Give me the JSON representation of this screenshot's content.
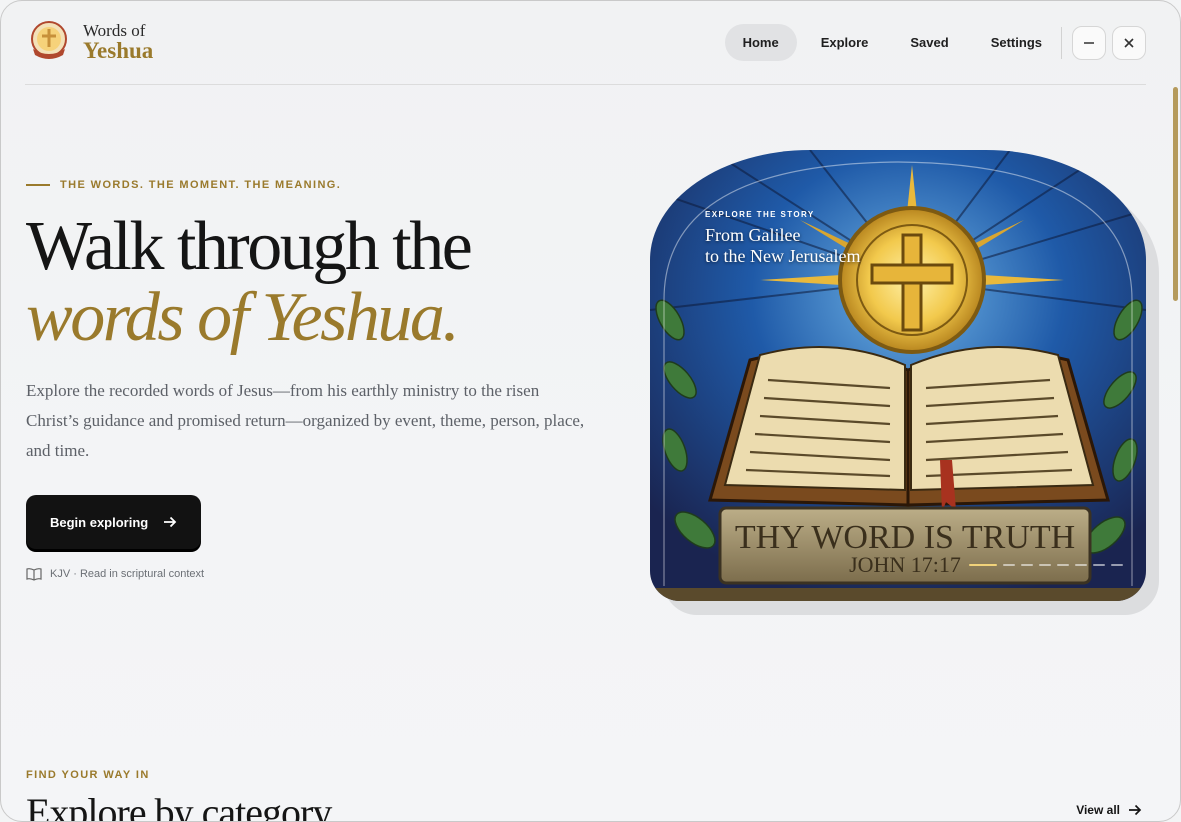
{
  "brand": {
    "top": "Words of",
    "main": "Yeshua"
  },
  "nav": [
    {
      "label": "Home",
      "active": true
    },
    {
      "label": "Explore",
      "active": false
    },
    {
      "label": "Saved",
      "active": false
    },
    {
      "label": "Settings",
      "active": false
    }
  ],
  "window_controls": {
    "minimize_icon": "minus-icon",
    "close_icon": "close-icon"
  },
  "hero": {
    "eyebrow": "THE WORDS. THE MOMENT. THE MEANING.",
    "title_line1": "Walk through the",
    "title_line2": "words of Yeshua.",
    "lede": "Explore the recorded words of Jesus—from his earthly ministry to the risen Christ’s guidance and promised return—organized by event, theme, person, place, and time.",
    "cta_label": "Begin exploring",
    "note": "KJV · Read in scriptural context"
  },
  "feature_card": {
    "eyebrow": "EXPLORE THE STORY",
    "title_line1": "From Galilee",
    "title_line2": "to the New Jerusalem",
    "image_text_line1": "THY WORD IS TRUTH",
    "image_text_line2": "JOHN 17:17",
    "slide_count": 8,
    "active_slide": 1
  },
  "category_section": {
    "eyebrow": "FIND YOUR WAY IN",
    "title": "Explore by category",
    "view_all": "View all"
  },
  "colors": {
    "accent": "#9a7a2c",
    "text": "#151515",
    "cta": "#121212"
  }
}
